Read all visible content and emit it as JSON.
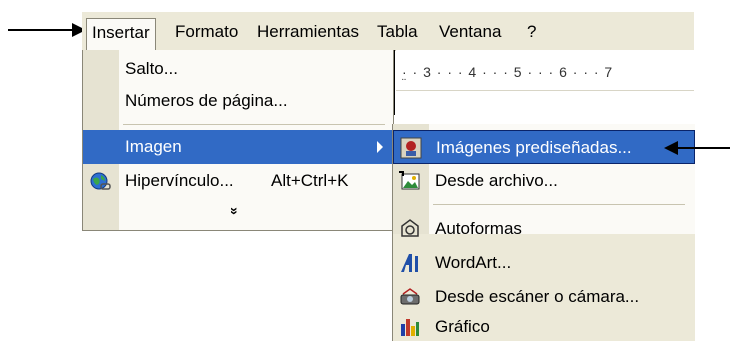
{
  "menubar": {
    "items": [
      {
        "label": "Insertar",
        "active": true
      },
      {
        "label": "Formato"
      },
      {
        "label": "Herramientas"
      },
      {
        "label": "Tabla"
      },
      {
        "label": "Ventana"
      },
      {
        "label": "?"
      }
    ]
  },
  "ruler": {
    "text": "· · 3 · · · 4 · · · 5 · · · 6 · · · 7",
    "marker": "¨"
  },
  "insert_menu": {
    "items": [
      {
        "label": "Salto..."
      },
      {
        "label": "Números de página..."
      },
      {
        "label": "Imagen",
        "highlighted": true,
        "has_submenu": true
      },
      {
        "label": "Hipervínculo...",
        "shortcut": "Alt+Ctrl+K",
        "icon": "globe-link-icon"
      }
    ],
    "expand_label": "»",
    "expand_icon": "chevron-double-down-icon"
  },
  "image_submenu": {
    "items": [
      {
        "label": "Imágenes prediseñadas...",
        "highlighted": true,
        "icon": "clipart-icon"
      },
      {
        "label": "Desde archivo...",
        "icon": "picture-file-icon"
      },
      {
        "label": "Autoformas",
        "icon": "autoshapes-icon"
      },
      {
        "label": "WordArt...",
        "icon": "wordart-icon"
      },
      {
        "label": "Desde escáner o cámara...",
        "icon": "scanner-camera-icon"
      },
      {
        "label": "Gráfico",
        "icon": "chart-icon"
      }
    ]
  },
  "colors": {
    "highlight": "#316ac5",
    "menu_bg": "#fbfaf6",
    "bar_bg": "#ece9d8"
  }
}
